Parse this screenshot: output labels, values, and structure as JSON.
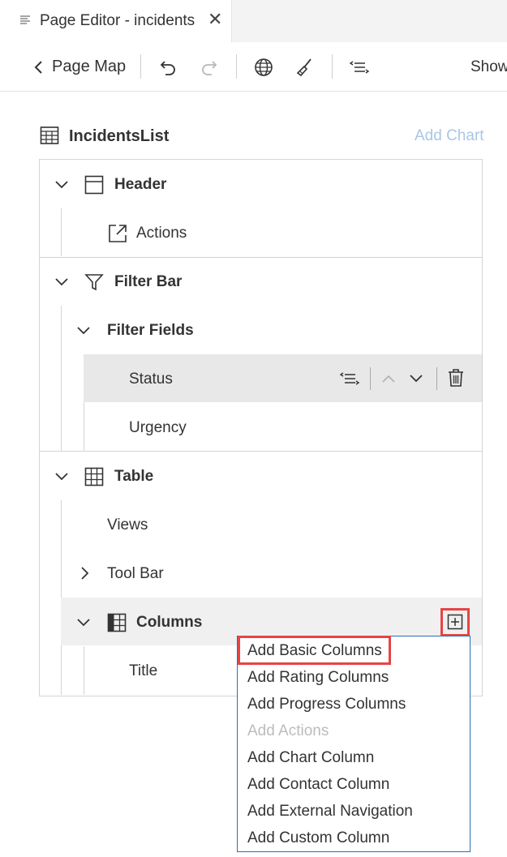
{
  "tab": {
    "title": "Page Editor - incidents",
    "close_glyph": "✕"
  },
  "toolbar": {
    "page_map_label": "Page Map",
    "show_label": "Show"
  },
  "outline": {
    "title": "IncidentsList",
    "add_chart_label": "Add Chart",
    "header": {
      "label": "Header",
      "actions_label": "Actions"
    },
    "filter_bar": {
      "label": "Filter Bar",
      "filter_fields_label": "Filter Fields",
      "fields": [
        "Status",
        "Urgency"
      ]
    },
    "table": {
      "label": "Table",
      "views_label": "Views",
      "tool_bar_label": "Tool Bar",
      "columns_label": "Columns",
      "column_items": [
        "Title"
      ]
    }
  },
  "add_menu": {
    "items": [
      {
        "label": "Add Basic Columns",
        "enabled": true,
        "highlighted": true
      },
      {
        "label": "Add Rating Columns",
        "enabled": true
      },
      {
        "label": "Add Progress Columns",
        "enabled": true
      },
      {
        "label": "Add Actions",
        "enabled": false
      },
      {
        "label": "Add Chart Column",
        "enabled": true
      },
      {
        "label": "Add Contact Column",
        "enabled": true
      },
      {
        "label": "Add External Navigation",
        "enabled": true
      },
      {
        "label": "Add Custom Column",
        "enabled": true
      }
    ]
  },
  "colors": {
    "accent_blue": "#2a6fb5",
    "highlight_red": "#e64545",
    "disabled_link": "#a9c6e8"
  }
}
